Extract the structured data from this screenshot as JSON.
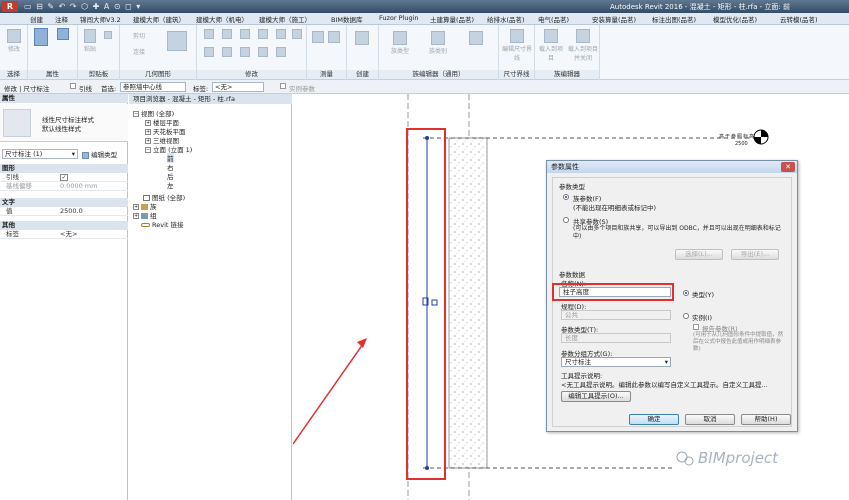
{
  "titlebar": {
    "app_icon": "R",
    "qat": "▭ ⊟ ✎ ↶ ↷ ⬡ ✚ A ⊙ ◻ ▾",
    "title": "Autodesk Revit 2016 -   混凝土 - 矩形 - 柱.rfa - 立面: 前"
  },
  "tabs": [
    "创建",
    "注释",
    "锦闯大师V3.2",
    "建模大师（建筑）",
    "建模大师（机电）",
    "建模大师（施工）",
    "BIM数据库",
    "Fuzor Plugin",
    "土建算量(品茗)",
    "给排水(品茗)",
    "电气(品茗)",
    "安装算量(品茗)",
    "标注出图(品茗)",
    "模型优化(品茗)",
    "云转模(品茗)"
  ],
  "ribbon": {
    "modify_label": "修改",
    "select_label": "选择",
    "groups": [
      "属性",
      "剪贴板",
      "几何图形",
      "修改",
      "测量",
      "创建",
      "族编辑器（通用）",
      "尺寸界线",
      "族编辑器"
    ],
    "buttons": {
      "paste": "粘贴",
      "cut": "剪切",
      "connect": "连接",
      "edit_witness": "编辑尺寸界线",
      "load_project": "载入到项目",
      "load_project_close": "载入到项目并关闭",
      "family_types": "族类型",
      "family_category": "族类别"
    }
  },
  "optionsbar": {
    "context": "修改 | 尺寸标注",
    "leader_label": "引线",
    "pref_label": "首选:",
    "pref_value": "参照墙中心线",
    "label_label": "标签:",
    "label_value": "<无>",
    "instance_label": "实例参数"
  },
  "properties": {
    "header": "属性",
    "type_name_line1": "线性尺寸标注样式",
    "type_name_line2": "默认线性样式",
    "selector": "尺寸标注 (1)",
    "edit_type": "编辑类型",
    "sections": [
      {
        "title": "图形",
        "rows": [
          {
            "k": "引线",
            "v": "✓"
          },
          {
            "k": "基线偏移",
            "v": "0.0000 mm"
          }
        ]
      },
      {
        "title": "文字",
        "rows": [
          {
            "k": "值",
            "v": "2500.0"
          }
        ]
      },
      {
        "title": "其他",
        "rows": [
          {
            "k": "标签",
            "v": "<无>"
          }
        ]
      }
    ]
  },
  "browser": {
    "title": "项目浏览器 - 混凝土 - 矩形 - 柱.rfa",
    "items": [
      {
        "label": "视图 (全部)",
        "exp": "−"
      },
      {
        "label": "楼层平面",
        "exp": "+"
      },
      {
        "label": "天花板平面",
        "exp": "+"
      },
      {
        "label": "三维视图",
        "exp": "+"
      },
      {
        "label": "立面 (立面 1)",
        "exp": "−"
      },
      {
        "label": "前",
        "exp": ""
      },
      {
        "label": "右",
        "exp": ""
      },
      {
        "label": "后",
        "exp": ""
      },
      {
        "label": "左",
        "exp": ""
      },
      {
        "label": "图纸 (全部)",
        "exp": ""
      },
      {
        "label": "族",
        "exp": "+"
      },
      {
        "label": "组",
        "exp": "+"
      },
      {
        "label": "Revit 链接",
        "exp": ""
      }
    ]
  },
  "canvas": {
    "level_name": "高于参照标高",
    "level_value": "2500",
    "watermark": "BIMproject"
  },
  "dialog": {
    "title": "参数属性",
    "close": "✕",
    "param_type_label": "参数类型",
    "family_param": "族参数(F)",
    "family_param_desc": "(不能出现在明细表或标记中)",
    "shared_param": "共享参数(S)",
    "shared_param_desc": "(可以由多个项目和族共享，可以导出到 ODBC，并且可以出现在明细表和标记中)",
    "select_btn": "选择(L)...",
    "export_btn": "导出(E)...",
    "param_data_label": "参数数据",
    "name_label": "名称(N):",
    "name_value": "柱子高度",
    "discipline_label": "规程(D):",
    "discipline_value": "公共",
    "type_radio": "类型(Y)",
    "instance_radio": "实例(I)",
    "param_type2_label": "参数类型(T):",
    "param_type2_value": "长度",
    "report_param": "报告参数(R)",
    "report_desc": "(可用于从几何图形条件中提取值，然后在公式中报告此值或用作明细表参数)",
    "group_label": "参数分组方式(G):",
    "group_value": "尺寸标注",
    "tooltip_label": "工具提示说明:",
    "tooltip_value": "<无工具提示说明。编辑此参数以编写自定义工具提示。自定义工具提...",
    "edit_tooltip_btn": "编辑工具提示(O)...",
    "ok": "确定",
    "cancel": "取消",
    "help": "帮助(H)"
  },
  "colors": {
    "annotation_red": "#e03030",
    "dimension_blue": "#1f3fa8"
  }
}
